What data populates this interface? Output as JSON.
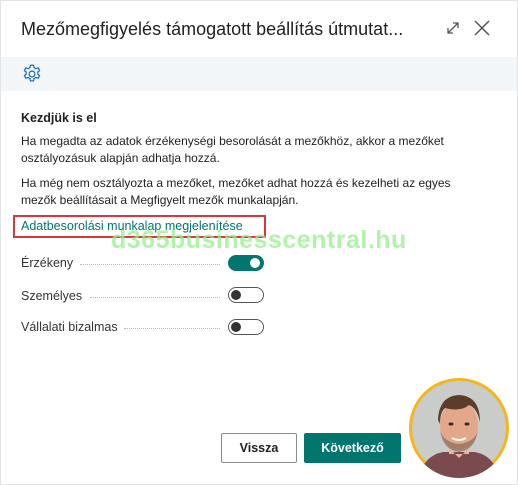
{
  "dialog": {
    "title": "Mezőmegfigyelés támogatott beállítás útmutat...",
    "expand_icon": "expand-icon",
    "close_icon": "close-icon"
  },
  "actionbar": {
    "settings_icon": "gear-icon"
  },
  "content": {
    "section_title": "Kezdjük is el",
    "paragraph1_line1": "Ha megadta az adatok érzékenységi besorolását a mezőkhöz, akkor a mezőket",
    "paragraph1_line2": "osztályozásuk alapján adhatja hozzá.",
    "paragraph2_line1": "Ha még nem osztályozta a mezőket, mezőket adhat hozzá és kezelheti az egyes",
    "paragraph2_line2": "mezők beállításait a Megfigyelt mezők munkalapján.",
    "link": "Adatbesorolási munkalap megjelenítése",
    "watermark": "d365businesscentral.hu"
  },
  "toggles": [
    {
      "label": "Érzékeny",
      "on": true
    },
    {
      "label": "Személyes",
      "on": false
    },
    {
      "label": "Vállalati bizalmas",
      "on": false
    }
  ],
  "footer": {
    "back_label": "Vissza",
    "next_label": "Következő"
  },
  "colors": {
    "accent": "#00766f",
    "highlight_box": "#d9363e",
    "watermark": "#97ef8d",
    "avatar_ring": "#f5b51e"
  }
}
